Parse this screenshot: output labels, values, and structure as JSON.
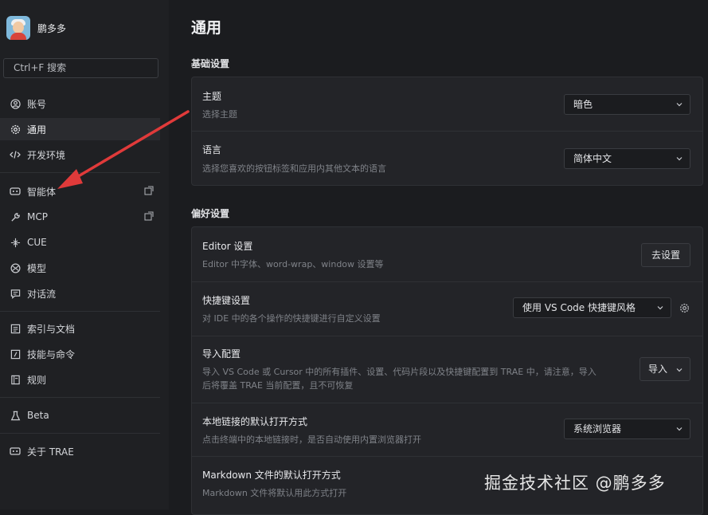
{
  "user": {
    "name": "鹏多多"
  },
  "search": {
    "placeholder": "Ctrl+F 搜索"
  },
  "sidebar": {
    "items": [
      {
        "label": "账号",
        "icon": "user-circle-icon"
      },
      {
        "label": "通用",
        "icon": "gear-icon"
      },
      {
        "label": "开发环境",
        "icon": "code-icon"
      },
      {
        "label": "智能体",
        "icon": "bot-icon"
      },
      {
        "label": "MCP",
        "icon": "wrench-icon"
      },
      {
        "label": "CUE",
        "icon": "cue-icon"
      },
      {
        "label": "模型",
        "icon": "model-icon"
      },
      {
        "label": "对话流",
        "icon": "chat-flow-icon"
      },
      {
        "label": "索引与文档",
        "icon": "index-icon"
      },
      {
        "label": "技能与命令",
        "icon": "command-icon"
      },
      {
        "label": "规则",
        "icon": "rules-icon"
      },
      {
        "label": "Beta",
        "icon": "beta-icon"
      },
      {
        "label": "关于 TRAE",
        "icon": "about-icon"
      }
    ],
    "active": "通用"
  },
  "main": {
    "title": "通用",
    "basic": {
      "title": "基础设置",
      "theme": {
        "title": "主题",
        "desc": "选择主题",
        "value": "暗色"
      },
      "language": {
        "title": "语言",
        "desc": "选择您喜欢的按钮标签和应用内其他文本的语言",
        "value": "简体中文"
      }
    },
    "prefs": {
      "title": "偏好设置",
      "editor": {
        "title": "Editor 设置",
        "desc": "Editor 中字体、word-wrap、window 设置等",
        "button": "去设置"
      },
      "shortcuts": {
        "title": "快捷键设置",
        "desc": "对 IDE 中的各个操作的快捷键进行自定义设置",
        "value": "使用 VS Code 快捷键风格"
      },
      "import": {
        "title": "导入配置",
        "desc_line1": "导入 VS Code 或 Cursor 中的所有插件、设置、代码片段以及快捷键配置到 TRAE 中，请注意，导入",
        "desc_line2": "后将覆盖 TRAE 当前配置，且不可恢复",
        "button": "导入"
      },
      "local_links": {
        "title": "本地链接的默认打开方式",
        "desc": "点击终端中的本地链接时，是否自动使用内置浏览器打开",
        "value": "系统浏览器"
      },
      "markdown": {
        "title": "Markdown 文件的默认打开方式",
        "desc": "Markdown 文件将默认用此方式打开"
      }
    }
  },
  "watermark": "掘金技术社区 @鹏多多",
  "colors": {
    "background": "#1b1c1f",
    "sidebar": "#1f2023",
    "card": "#232428",
    "arrow": "#e03a3a"
  }
}
